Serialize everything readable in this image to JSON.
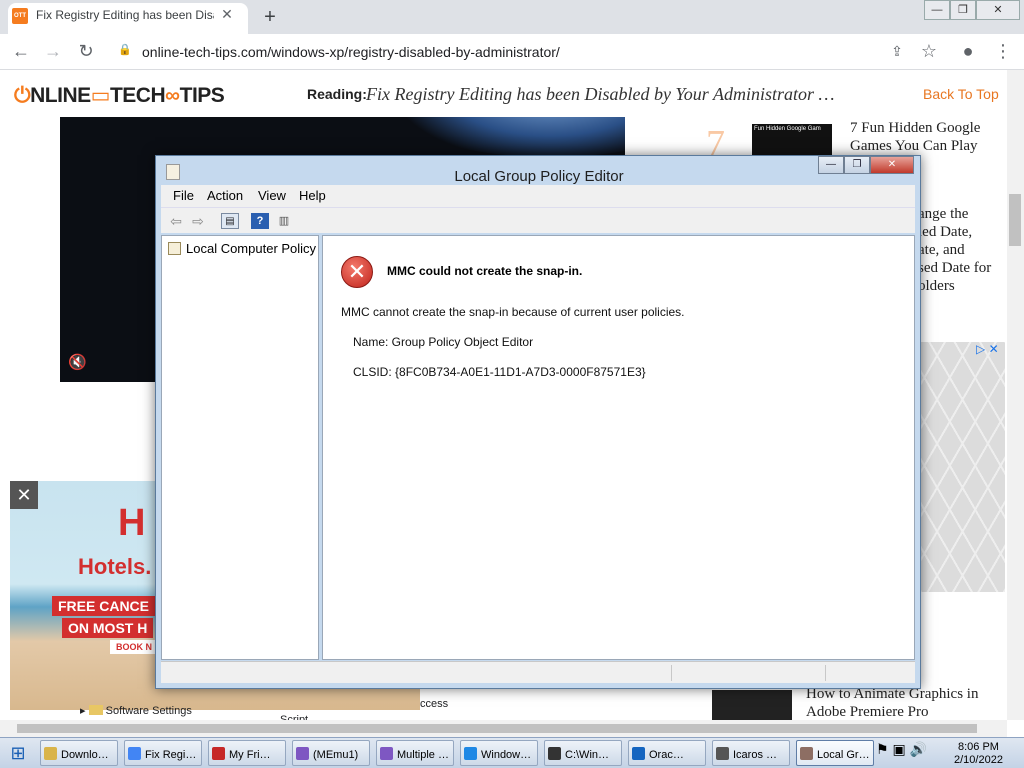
{
  "browser": {
    "tab_title": "Fix Registry Editing has been Disabled by Your Administrator",
    "tab_favicon": "OTT",
    "new_tab": "+",
    "window_buttons": [
      "—",
      "❐",
      "✕"
    ],
    "url": "online-tech-tips.com/windows-xp/registry-disabled-by-administrator/",
    "nav": {
      "back": "←",
      "forward": "→",
      "reload": "↻",
      "lock": "🔒",
      "share": "⇪",
      "star": "☆",
      "profile": "●",
      "menu": "⋮"
    }
  },
  "site": {
    "logo_a": "",
    "logo_b": "NLINE",
    "logo_c": "TECH",
    "logo_d": "TIPS",
    "reading_label": "Reading:",
    "reading_title": "Fix Registry Editing has been Disabled by Your Administrator …",
    "back_to_top": "Back To Top"
  },
  "page": {
    "mute_icon": "🔇",
    "side_number": "7",
    "side_thumb_caption": "Fun Hidden Google Gam",
    "side_article_1": [
      "7 Fun Hidden Google",
      "Games You Can Play"
    ],
    "side_article_2": [
      "ange the",
      "ied Date,",
      "ate, and",
      "sed Date for",
      "olders"
    ],
    "side_article_3": [
      "How to Animate Graphics in",
      "Adobe Premiere Pro"
    ],
    "ad_close": "✕",
    "ad_brand": "Hotels.",
    "ad_icon": "H",
    "ad_line_1": "FREE CANCE",
    "ad_line_2": "ON MOST H",
    "ad_book": "BOOK N",
    "ad_choices": "▷ ✕",
    "behind_text_1": "Software Settings",
    "behind_text_2": "ccess",
    "behind_text_3": "Script"
  },
  "dialog": {
    "title": "Local Group Policy Editor",
    "buttons": [
      "—",
      "❐",
      "✕"
    ],
    "menu": [
      "File",
      "Action",
      "View",
      "Help"
    ],
    "tree_item": "Local Computer Policy",
    "error_icon": "✕",
    "error_heading": "MMC could not create the snap-in.",
    "error_message": "MMC cannot create the snap-in because of current user policies.",
    "name_line": "Name: Group Policy Object Editor",
    "clsid_line": "CLSID: {8FC0B734-A0E1-11D1-A7D3-0000F87571E3}",
    "toolbar_icons": [
      "back-arrow",
      "forward-arrow",
      "show-hide-tree",
      "help",
      "show-hide-action-pane"
    ]
  },
  "taskbar": {
    "start_icon": "⊞",
    "items": [
      {
        "label": "Downlo…",
        "color": "#d9b44a"
      },
      {
        "label": "Fix Regi…",
        "color": "#4285f4"
      },
      {
        "label": "My Fri…",
        "color": "#c62828"
      },
      {
        "label": "(MEmu1)",
        "color": "#7e57c2"
      },
      {
        "label": "Multiple …",
        "color": "#7e57c2"
      },
      {
        "label": "Window…",
        "color": "#1e88e5"
      },
      {
        "label": "C:\\Win…",
        "color": "#333333"
      },
      {
        "label": "Orac…",
        "color": "#1565c0"
      },
      {
        "label": "Icaros …",
        "color": "#555555"
      },
      {
        "label": "Local Gr…",
        "color": "#8d6e63"
      }
    ],
    "time": "8:06 PM",
    "date": "2/10/2022"
  }
}
